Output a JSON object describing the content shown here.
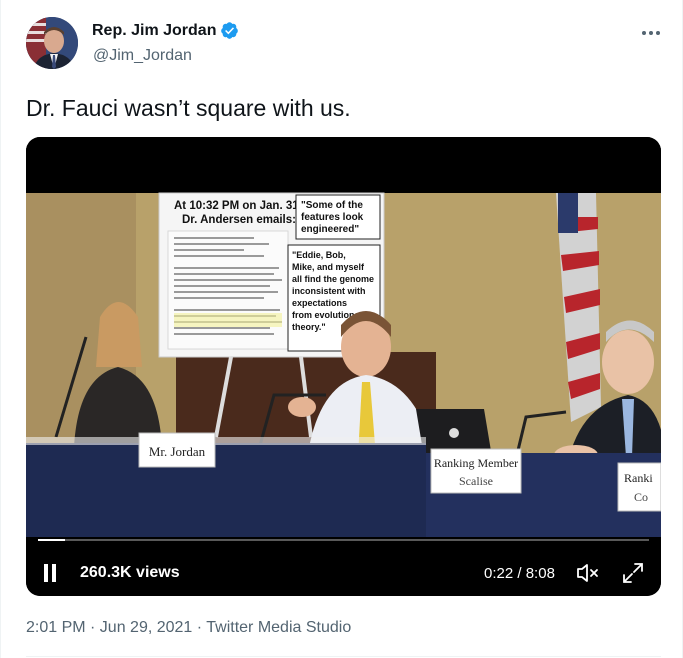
{
  "author": {
    "display_name": "Rep. Jim Jordan",
    "handle": "@Jim_Jordan",
    "verified": true,
    "avatar_icon": "profile-photo"
  },
  "tweet": {
    "text": "Dr. Fauci wasn’t square with us."
  },
  "video": {
    "sign_header": "At 10:32 PM on Jan. 31,",
    "sign_header2": "Dr. Andersen emails:",
    "quote1_line1": "\"Some of the",
    "quote1_line2": "features look",
    "quote1_line3": "engineered\"",
    "quote2_line1": "\"Eddie, Bob,",
    "quote2_line2": "Mike, and myself",
    "quote2_line3": "all find the genome",
    "quote2_line4": "inconsistent with",
    "quote2_line5": "expectations",
    "quote2_line6": "from evolutionary",
    "quote2_line7": "theory.\"",
    "nameplate_jordan": "Mr. Jordan",
    "nameplate_ranking1": "Ranking Member",
    "nameplate_ranking1b": "Scalise",
    "nameplate_ranking2": "Ranki",
    "nameplate_ranking2b": "Co",
    "views": "260.3K views",
    "current_time": "0:22",
    "duration": "8:08",
    "time_separator": " / ",
    "progress_fraction": 0.045
  },
  "meta": {
    "timestamp": "2:01 PM · Jun 29, 2021",
    "separator": " · ",
    "source": "Twitter Media Studio"
  },
  "colors": {
    "verified_blue": "#1d9bf0",
    "secondary_text": "#536471"
  }
}
